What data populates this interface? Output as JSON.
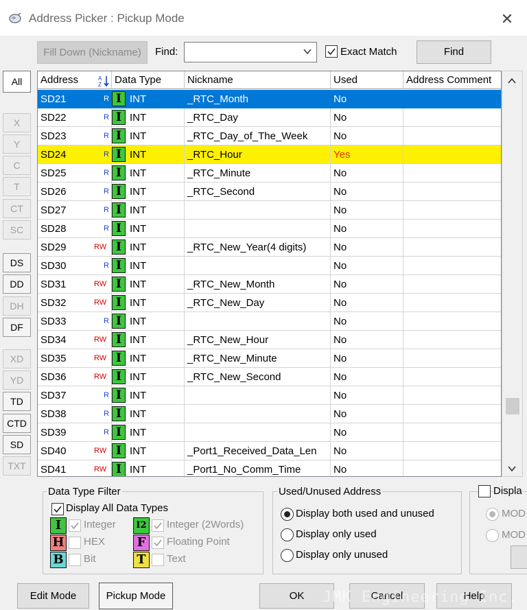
{
  "window": {
    "title": "Address Picker : Pickup Mode",
    "close_glyph": "✕"
  },
  "toolbar": {
    "fill_down_label": "Fill Down (Nickname)",
    "find_label": "Find:",
    "find_value": "",
    "exact_match_label": "Exact Match",
    "exact_match_checked": true,
    "find_button_label": "Find"
  },
  "side_buttons": [
    {
      "label": "All",
      "enabled": true
    },
    {
      "label": "X",
      "enabled": false
    },
    {
      "label": "Y",
      "enabled": false
    },
    {
      "label": "C",
      "enabled": false
    },
    {
      "label": "T",
      "enabled": false
    },
    {
      "label": "CT",
      "enabled": false
    },
    {
      "label": "SC",
      "enabled": false
    },
    {
      "label": "DS",
      "enabled": true
    },
    {
      "label": "DD",
      "enabled": true
    },
    {
      "label": "DH",
      "enabled": false
    },
    {
      "label": "DF",
      "enabled": true
    },
    {
      "label": "XD",
      "enabled": false
    },
    {
      "label": "YD",
      "enabled": false
    },
    {
      "label": "TD",
      "enabled": true
    },
    {
      "label": "CTD",
      "enabled": true
    },
    {
      "label": "SD",
      "enabled": true
    },
    {
      "label": "TXT",
      "enabled": false
    }
  ],
  "grid": {
    "columns": [
      "Address",
      "Data Type",
      "Nickname",
      "Used",
      "Address Comment"
    ],
    "sort_icon": "A↓Z",
    "type_badge": "I",
    "rows": [
      {
        "address": "SD21",
        "rw": "R",
        "type": "INT",
        "nickname": "_RTC_Month",
        "used": "No",
        "selected": true
      },
      {
        "address": "SD22",
        "rw": "R",
        "type": "INT",
        "nickname": "_RTC_Day",
        "used": "No"
      },
      {
        "address": "SD23",
        "rw": "R",
        "type": "INT",
        "nickname": "_RTC_Day_of_The_Week",
        "used": "No"
      },
      {
        "address": "SD24",
        "rw": "R",
        "type": "INT",
        "nickname": "_RTC_Hour",
        "used": "Yes",
        "highlight": true
      },
      {
        "address": "SD25",
        "rw": "R",
        "type": "INT",
        "nickname": "_RTC_Minute",
        "used": "No"
      },
      {
        "address": "SD26",
        "rw": "R",
        "type": "INT",
        "nickname": "_RTC_Second",
        "used": "No"
      },
      {
        "address": "SD27",
        "rw": "R",
        "type": "INT",
        "nickname": "",
        "used": "No"
      },
      {
        "address": "SD28",
        "rw": "R",
        "type": "INT",
        "nickname": "",
        "used": "No"
      },
      {
        "address": "SD29",
        "rw": "RW",
        "type": "INT",
        "nickname": "_RTC_New_Year(4 digits)",
        "used": "No"
      },
      {
        "address": "SD30",
        "rw": "R",
        "type": "INT",
        "nickname": "",
        "used": "No"
      },
      {
        "address": "SD31",
        "rw": "RW",
        "type": "INT",
        "nickname": "_RTC_New_Month",
        "used": "No"
      },
      {
        "address": "SD32",
        "rw": "RW",
        "type": "INT",
        "nickname": "_RTC_New_Day",
        "used": "No"
      },
      {
        "address": "SD33",
        "rw": "R",
        "type": "INT",
        "nickname": "",
        "used": "No"
      },
      {
        "address": "SD34",
        "rw": "RW",
        "type": "INT",
        "nickname": "_RTC_New_Hour",
        "used": "No"
      },
      {
        "address": "SD35",
        "rw": "RW",
        "type": "INT",
        "nickname": "_RTC_New_Minute",
        "used": "No"
      },
      {
        "address": "SD36",
        "rw": "RW",
        "type": "INT",
        "nickname": "_RTC_New_Second",
        "used": "No"
      },
      {
        "address": "SD37",
        "rw": "R",
        "type": "INT",
        "nickname": "",
        "used": "No"
      },
      {
        "address": "SD38",
        "rw": "R",
        "type": "INT",
        "nickname": "",
        "used": "No"
      },
      {
        "address": "SD39",
        "rw": "R",
        "type": "INT",
        "nickname": "",
        "used": "No"
      },
      {
        "address": "SD40",
        "rw": "RW",
        "type": "INT",
        "nickname": "_Port1_Received_Data_Len",
        "used": "No"
      },
      {
        "address": "SD41",
        "rw": "RW",
        "type": "INT",
        "nickname": "_Port1_No_Comm_Time",
        "used": "No"
      }
    ]
  },
  "filter": {
    "title": "Data Type Filter",
    "display_all_label": "Display All Data Types",
    "display_all_checked": true,
    "types": [
      {
        "badge": "I",
        "label": "Integer",
        "checked": true,
        "color": "#3ec63e"
      },
      {
        "badge": "I2",
        "label": "Integer (2Words)",
        "checked": true,
        "color": "#3ec63e"
      },
      {
        "badge": "H",
        "label": "HEX",
        "checked": false,
        "color": "#f08080"
      },
      {
        "badge": "F",
        "label": "Floating Point",
        "checked": true,
        "color": "#e070e0"
      },
      {
        "badge": "B",
        "label": "Bit",
        "checked": false,
        "color": "#6ad6d6"
      },
      {
        "badge": "T",
        "label": "Text",
        "checked": false,
        "color": "#f0e040"
      }
    ]
  },
  "usage": {
    "title": "Used/Unused Address",
    "options": [
      "Display both used and unused",
      "Display only used",
      "Display only unused"
    ],
    "selected": 0
  },
  "display_group": {
    "title": "Displa",
    "options": [
      "MOD",
      "MOD"
    ]
  },
  "footer": {
    "edit_mode_label": "Edit Mode",
    "pickup_mode_label": "Pickup Mode",
    "ok_label": "OK",
    "cancel_label": "Cancel",
    "help_label": "Help",
    "watermark": "JMK Engineering Inc."
  }
}
